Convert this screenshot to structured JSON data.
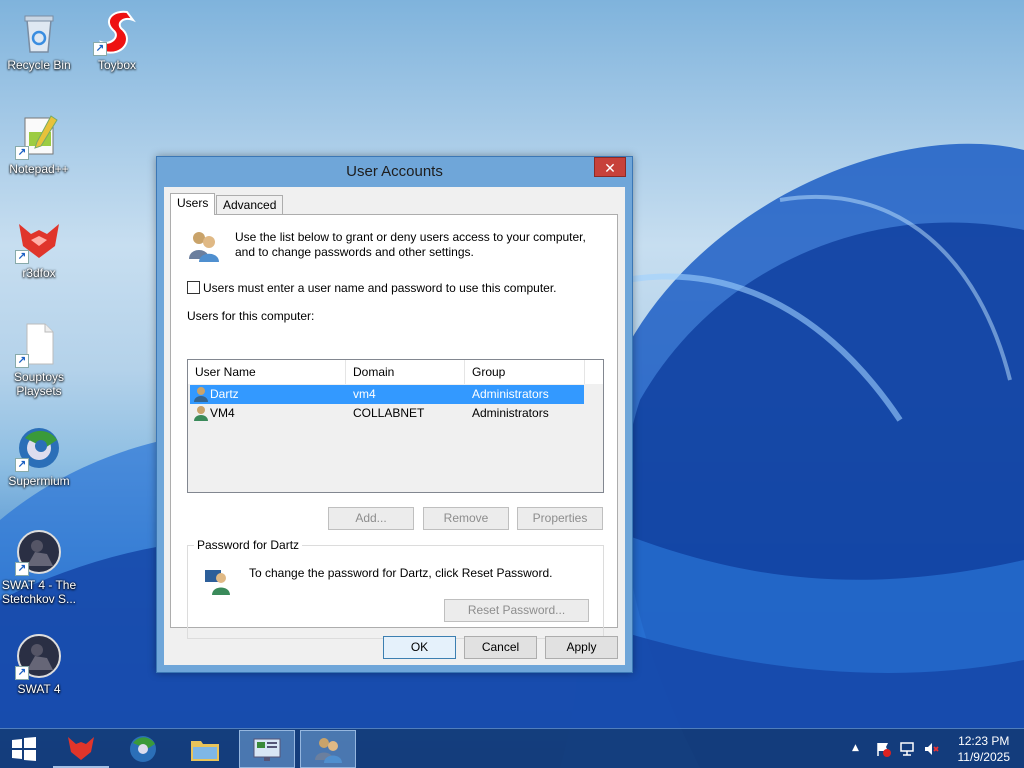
{
  "desktop": {
    "icons": [
      {
        "label": "Recycle Bin",
        "icon": "recycle-bin-icon"
      },
      {
        "label": "Toybox",
        "icon": "toybox-icon"
      },
      {
        "label": "Notepad++",
        "icon": "notepad-plus-plus-icon"
      },
      {
        "label": "r3dfox",
        "icon": "r3dfox-icon"
      },
      {
        "label": "Souptoys Playsets",
        "icon": "file-icon"
      },
      {
        "label": "Supermium",
        "icon": "supermium-icon"
      },
      {
        "label": "SWAT 4 - The Stetchkov S...",
        "icon": "swat4-icon"
      },
      {
        "label": "SWAT 4",
        "icon": "swat4-icon"
      }
    ]
  },
  "dialog": {
    "title": "User Accounts",
    "close_symbol": "✕",
    "tabs": [
      {
        "label": "Users",
        "active": true
      },
      {
        "label": "Advanced",
        "active": false
      }
    ],
    "intro_text_line1": "Use the list below to grant or deny users access to your computer,",
    "intro_text_line2": "and to change passwords and other settings.",
    "checkbox_label": "Users must enter a user name and password to use this computer.",
    "checkbox_checked": false,
    "users_label": "Users for this computer:",
    "columns": [
      "User Name",
      "Domain",
      "Group"
    ],
    "users": [
      {
        "name": "Dartz",
        "domain": "vm4",
        "group": "Administrators",
        "selected": true
      },
      {
        "name": "VM4",
        "domain": "COLLABNET",
        "group": "Administrators",
        "selected": false
      }
    ],
    "buttons": {
      "add": "Add...",
      "remove": "Remove",
      "properties": "Properties",
      "reset_password": "Reset Password...",
      "ok": "OK",
      "cancel": "Cancel",
      "apply": "Apply"
    },
    "password_group_label": "Password for Dartz",
    "password_text": "To change the password for Dartz, click Reset Password."
  },
  "taskbar": {
    "clock_time": "12:23 PM",
    "clock_date": "11/9/2025",
    "tray_chevron": "▲"
  },
  "colors": {
    "selection": "#3399ff",
    "close_button": "#c7413a",
    "dialog_frame": "#6fa6d9"
  }
}
